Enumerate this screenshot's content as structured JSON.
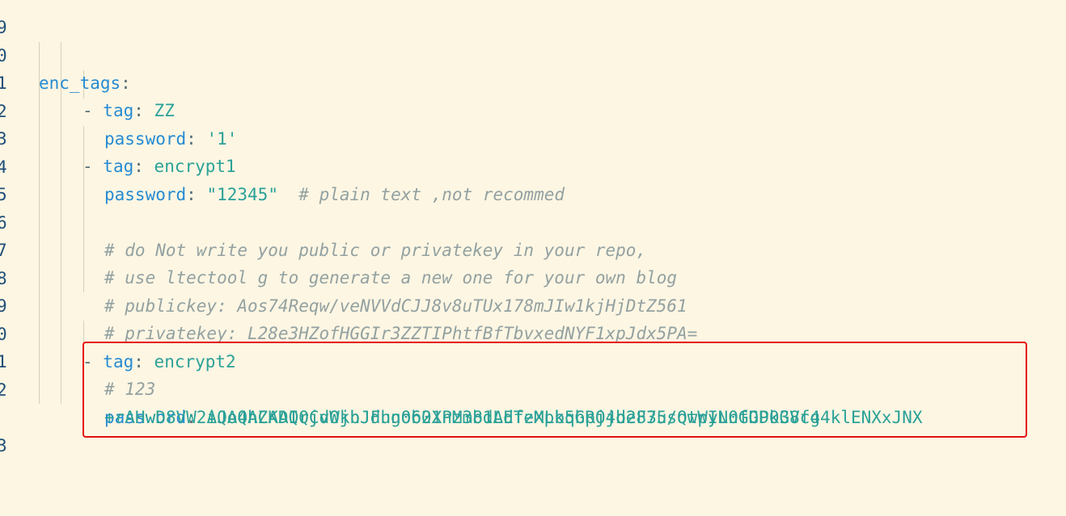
{
  "gutter": {
    "line_numbers": [
      "9",
      "0",
      "1",
      "2",
      "3",
      "4",
      "5",
      "6",
      "7",
      "8",
      "9",
      "0",
      "1",
      "2",
      "3"
    ]
  },
  "code": {
    "enc_tags_key": "enc_tags",
    "colon": ":",
    "dash": "- ",
    "tag_key": "tag",
    "password_key": "password",
    "tag1_value": "ZZ",
    "password1_value": "'1'",
    "tag2_value": "encrypt1",
    "password2_value": "\"12345\"",
    "password2_comment": "# plain text ,not recommed",
    "comment_do_not_write": "# do Not write you public or privatekey in your repo,",
    "comment_use_ltectool": "# use ltectool g to generate a new one for your own blog",
    "comment_publickey": "# publickey: Aos74Reqw/veNVVdCJJ8v8uTUx178mJIw1kjHjDtZ561",
    "comment_privatekey": "# privatekey: L28e3HZofHGGIr3ZZTIPhtfBfTbvxedNYF1xpJdx5PA=",
    "tag3_value": "encrypt2",
    "comment_123": "# 123",
    "password3_value_line1": "AQAQACAAIQCvWkhJdhn0b21Pz381AdTeMLb5bRO4d2F3usQtpIL0fDD0G8cg4klENXxJNX",
    "password3_value_line2": "+rAHwD8VW2iJo4hZKDQrjdOjbJFugo60XnMmbdLEfzXpkqGpjjbe875/owWyNnGGPk3Vf4"
  },
  "colors": {
    "background": "#fdf6e3",
    "key": "#268bd2",
    "value": "#2aa198",
    "comment": "#93a1a1",
    "line_number": "#1f4e79",
    "highlight_border": "#e41010"
  }
}
